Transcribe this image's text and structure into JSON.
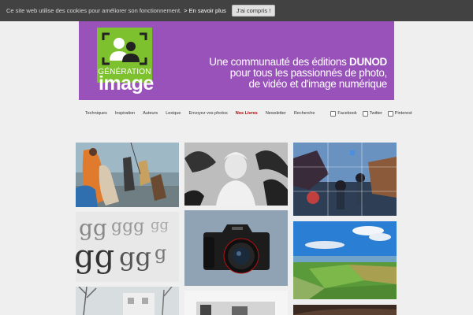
{
  "cookie": {
    "text": "Ce site web utilise des cookies pour améliorer son fonctionnement.",
    "more_link": "> En savoir plus",
    "accept_button": "J'ai compris !"
  },
  "banner": {
    "logo_generation": "GÉNÉRATION",
    "logo_image": "image",
    "tagline_line1_prefix": "Une communauté des éditions ",
    "tagline_brand": "DUNOD",
    "tagline_line2": "pour tous les passionnés de photo,",
    "tagline_line3": "de vidéo et d'image numérique",
    "color": "#9a52bb",
    "logo_color": "#7dc22e"
  },
  "nav": {
    "items": [
      "Techniques",
      "Inspiration",
      "Auteurs",
      "Lexique",
      "Envoyez vos photos",
      "Nos Livres",
      "Newsletter",
      "Recherche"
    ],
    "highlight_color": "#c00000",
    "social": [
      "Facebook",
      "Twitter",
      "Pinterest"
    ]
  },
  "gallery": [
    "people-fishing-photo",
    "woman-black-white-photo",
    "festival-grid-photo",
    "typography-letters-photo",
    "canon-camera-photo",
    "landscape-aerial-photo",
    "trees-building-photo",
    "dark-interior-photo",
    "eye-closeup-photo"
  ]
}
